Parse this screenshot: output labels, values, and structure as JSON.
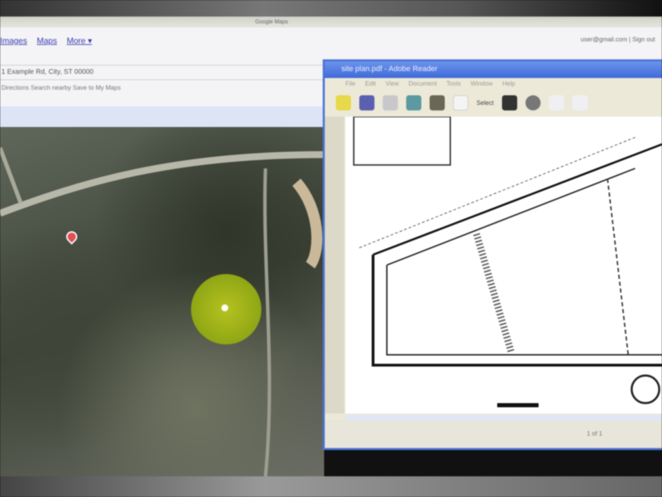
{
  "browser": {
    "tabs_text": "Google Maps",
    "nav_links": [
      "Images",
      "Maps",
      "More ▾"
    ],
    "account_text": "user@gmail.com | Sign out",
    "address_line": "1 Example Rd, City, ST 00000",
    "address_sub": "Directions  Search nearby  Save to My Maps"
  },
  "pdf_viewer": {
    "title": "site plan.pdf - Adobe Reader",
    "menu": [
      "File",
      "Edit",
      "View",
      "Document",
      "Tools",
      "Window",
      "Help"
    ],
    "select_label": "Select",
    "page_status": "1 of 1"
  },
  "colors": {
    "window_title": "#3e6ad8",
    "marker": "#e05050",
    "highlight": "#9bb016"
  }
}
